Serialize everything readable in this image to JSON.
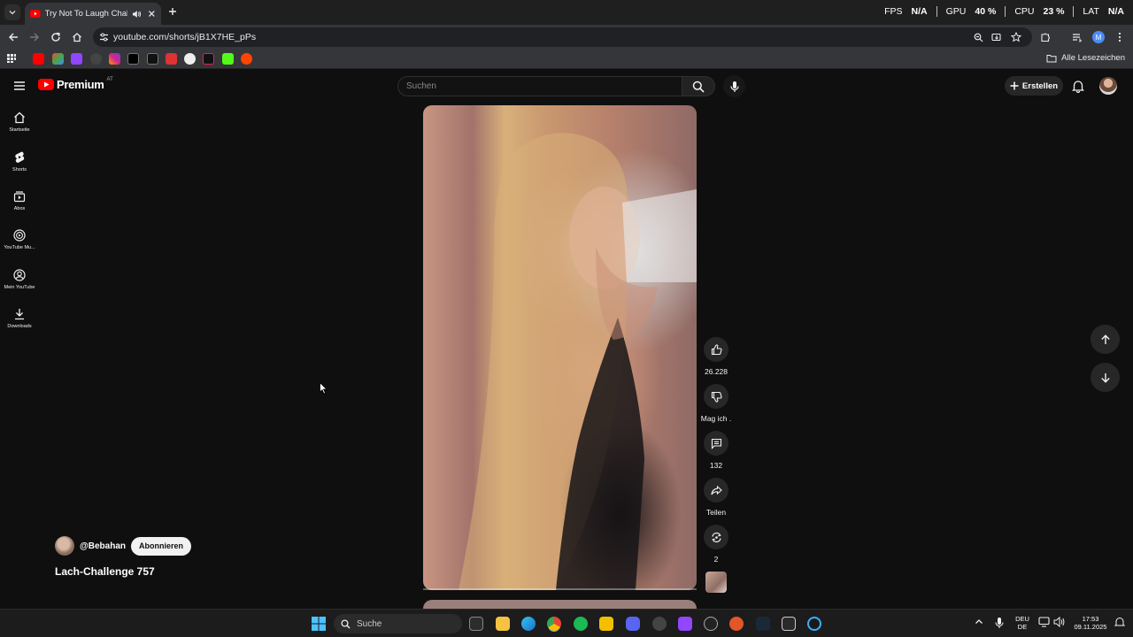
{
  "browser": {
    "tab_title": "Try Not To Laugh Challenge",
    "url": "youtube.com/shorts/jB1X7HE_pPs",
    "bookmarks_all_label": "Alle Lesezeichen",
    "profile_initial": "M"
  },
  "perf_overlay": {
    "fps_label": "FPS",
    "fps_value": "N/A",
    "gpu_label": "GPU",
    "gpu_value": "40 %",
    "cpu_label": "CPU",
    "cpu_value": "23 %",
    "lat_label": "LAT",
    "lat_value": "N/A"
  },
  "youtube": {
    "logo_text": "Premium",
    "region": "AT",
    "search_placeholder": "Suchen",
    "create_label": "Erstellen",
    "sidebar": [
      {
        "label": "Startseite",
        "icon": "home-icon"
      },
      {
        "label": "Shorts",
        "icon": "shorts-icon"
      },
      {
        "label": "Abos",
        "icon": "subscriptions-icon"
      },
      {
        "label": "YouTube Mu...",
        "icon": "youtube-music-icon"
      },
      {
        "label": "Mein YouTube",
        "icon": "my-youtube-icon"
      },
      {
        "label": "Downloads",
        "icon": "download-icon"
      }
    ],
    "short": {
      "channel": "@Bebahan",
      "subscribe_label": "Abonnieren",
      "title": "Lach-Challenge 757",
      "likes": "26.228",
      "dislike_label": "Mag ich .",
      "comments": "132",
      "share_label": "Teilen",
      "remix_count": "2"
    }
  },
  "taskbar": {
    "search_label": "Suche",
    "lang_top": "DEU",
    "lang_bottom": "DE",
    "time": "17:53",
    "date": "09.11.2025"
  },
  "colors": {
    "page_bg": "#0f0f0f",
    "yt_red": "#ff0000",
    "chip_bg": "#272727"
  }
}
